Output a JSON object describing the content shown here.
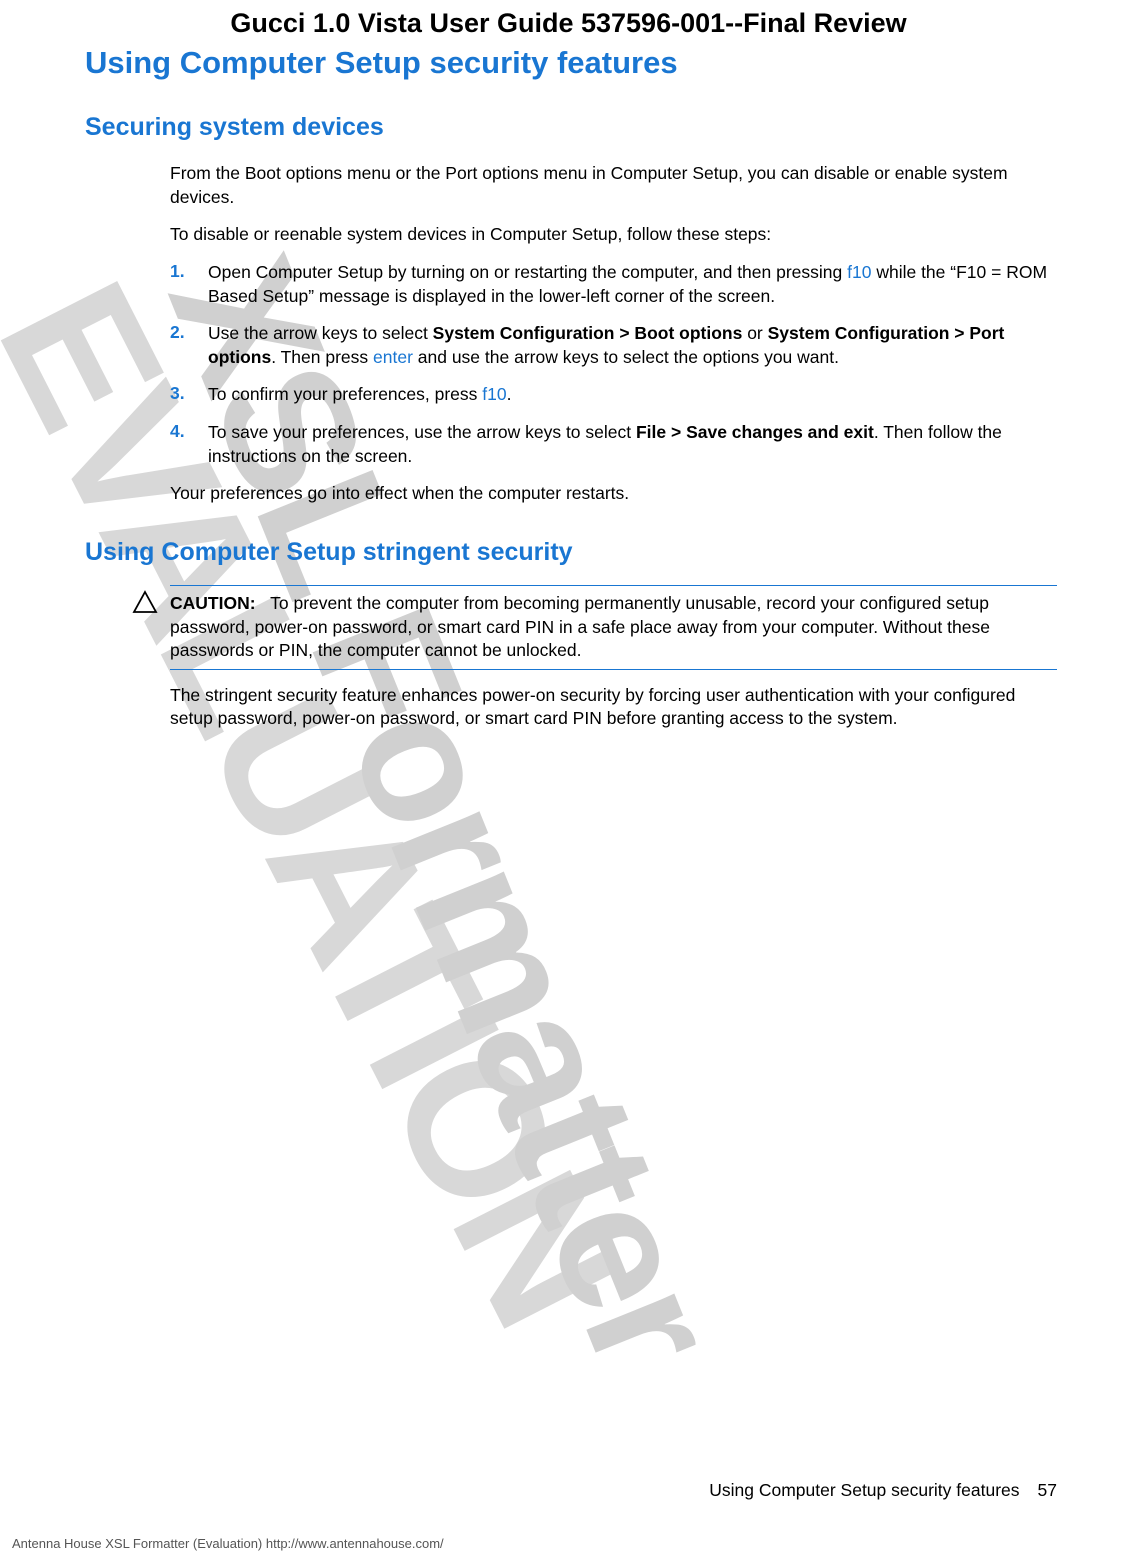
{
  "watermark": {
    "text1": "XSL Formatter",
    "text2": "EVALUATION"
  },
  "header": {
    "title": "Gucci 1.0 Vista User Guide 537596-001--Final Review"
  },
  "headings": {
    "main": "Using Computer Setup security features",
    "sub1": "Securing system devices",
    "sub2": "Using Computer Setup stringent security"
  },
  "section1": {
    "p1": "From the Boot options menu or the Port options menu in Computer Setup, you can disable or enable system devices.",
    "p2": "To disable or reenable system devices in Computer Setup, follow these steps:",
    "steps": [
      {
        "num": "1.",
        "pre": "Open Computer Setup by turning on or restarting the computer, and then pressing ",
        "key": "f10",
        "post": " while the “F10 = ROM Based Setup” message is displayed in the lower-left corner of the screen."
      },
      {
        "num": "2.",
        "pre": "Use the arrow keys to select ",
        "bold1": "System Configuration > Boot options",
        "mid": " or ",
        "bold2": "System Configuration > Port options",
        "post1": ". Then press ",
        "key": "enter",
        "post2": " and use the arrow keys to select the options you want."
      },
      {
        "num": "3.",
        "pre": "To confirm your preferences, press ",
        "key": "f10",
        "post": "."
      },
      {
        "num": "4.",
        "pre": "To save your preferences, use the arrow keys to select ",
        "bold1": "File > Save changes and exit",
        "post": ". Then follow the instructions on the screen."
      }
    ],
    "p3": "Your preferences go into effect when the computer restarts."
  },
  "section2": {
    "caution_label": "CAUTION:",
    "caution_text": "To prevent the computer from becoming permanently unusable, record your configured setup password, power-on password, or smart card PIN in a safe place away from your computer. Without these passwords or PIN, the computer cannot be unlocked.",
    "p1": "The stringent security feature enhances power-on security by forcing user authentication with your configured setup password, power-on password, or smart card PIN before granting access to the system."
  },
  "footer": {
    "section_name": "Using Computer Setup security features",
    "page_num": "57",
    "credit": "Antenna House XSL Formatter (Evaluation)  http://www.antennahouse.com/"
  }
}
